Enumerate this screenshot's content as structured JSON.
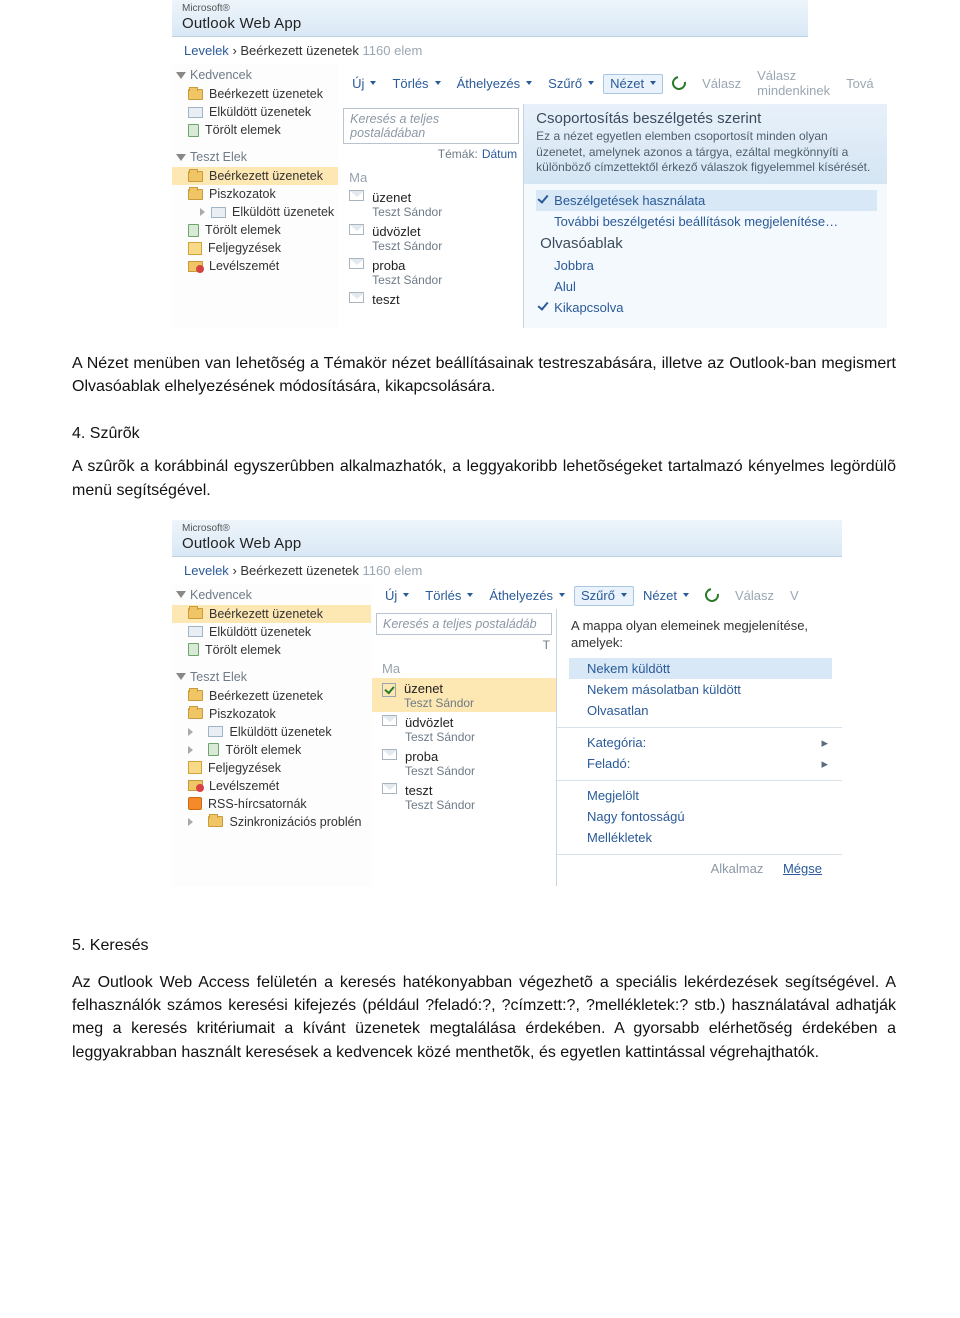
{
  "owa": {
    "ms": "Microsoft®",
    "app": "Outlook Web App",
    "breadcrumb_root": "Levelek",
    "breadcrumb_folder": "Beérkezett üzenetek",
    "breadcrumb_count": "1160 elem"
  },
  "sidebar1": {
    "fav_header": "Kedvencek",
    "fav": [
      "Beérkezett üzenetek",
      "Elküldött üzenetek",
      "Törölt elemek"
    ],
    "mbx_header": "Teszt Elek",
    "mbx": [
      "Beérkezett üzenetek",
      "Piszkozatok",
      "Elküldött üzenetek",
      "Törölt elemek",
      "Feljegyzések",
      "Levélszemét"
    ]
  },
  "sidebar2": {
    "fav_header": "Kedvencek",
    "fav": [
      "Beérkezett üzenetek",
      "Elküldött üzenetek",
      "Törölt elemek"
    ],
    "mbx_header": "Teszt Elek",
    "mbx": [
      "Beérkezett üzenetek",
      "Piszkozatok",
      "Elküldött üzenetek",
      "Törölt elemek",
      "Feljegyzések",
      "Levélszemét",
      "RSS-hírcsatornák",
      "Szinkronizációs problén"
    ]
  },
  "toolbar": {
    "new": "Új",
    "delete": "Törlés",
    "move": "Áthelyezés",
    "filter": "Szűrő",
    "view": "Nézet",
    "reply": "Válasz",
    "replyall": "Válasz mindenkinek",
    "forward": "Tová",
    "v_short": "V"
  },
  "search": {
    "placeholder": "Keresés a teljes postaládában",
    "placeholder_short": "Keresés a teljes postaládáb",
    "topics_label": "Témák:",
    "topics_value": "Dátum",
    "t_short": "T"
  },
  "messages": {
    "group": "Ma",
    "list": [
      {
        "subj": "üzenet",
        "from": "Teszt Sándor"
      },
      {
        "subj": "üdvözlet",
        "from": "Teszt Sándor"
      },
      {
        "subj": "proba",
        "from": "Teszt Sándor"
      },
      {
        "subj": "teszt",
        "from": "Teszt Sándor"
      }
    ]
  },
  "view_dd": {
    "title": "Csoportosítás beszélgetés szerint",
    "desc": "Ez a nézet egyetlen elemben csoportosít minden olyan üzenetet, amelynek azonos a tárgya, ezáltal megkönnyíti a különböző címzettektől érkező válaszok figyelemmel kísérését.",
    "opt_use": "Beszélgetések használata",
    "opt_more": "További beszélgetési beállítások megjelenítése…",
    "pane_hdr": "Olvasóablak",
    "pane_right": "Jobbra",
    "pane_bottom": "Alul",
    "pane_off": "Kikapcsolva"
  },
  "filter_dd": {
    "desc": "A mappa olyan elemeinek megjelenítése, amelyek:",
    "to_me": "Nekem küldött",
    "cc_me": "Nekem másolatban küldött",
    "unread": "Olvasatlan",
    "category": "Kategória:",
    "from": "Feladó:",
    "flagged": "Megjelölt",
    "high": "Nagy fontosságú",
    "attach": "Mellékletek",
    "apply": "Alkalmaz",
    "cancel": "Mégse"
  },
  "doc": {
    "p1": "A Nézet menüben van lehetõség a Témakör nézet beállításainak testreszabására, illetve az Outlook-ban megismert Olvasóablak elhelyezésének módosítására, kikapcsolására.",
    "h2": "4. Szûrõk",
    "p2": "A szûrõk a korábbinál egyszerûbben alkalmazhatók, a leggyakoribb lehetõségeket tartalmazó kényelmes legördülõ menü segítségével.",
    "h3": "5. Keresés",
    "p3": "Az Outlook Web Access felületén a keresés hatékonyabban végezhetõ a speciális lekérdezések segítségével. A felhasználók számos keresési kifejezés (például ?feladó:?, ?címzett:?, ?mellékletek:? stb.) használatával adhatják meg a keresés kritériumait a kívánt üzenetek megtalálása érdekében. A gyorsabb elérhetõség érdekében a leggyakrabban használt keresések a kedvencek közé menthetõk, és egyetlen kattintással végrehajthatók."
  }
}
